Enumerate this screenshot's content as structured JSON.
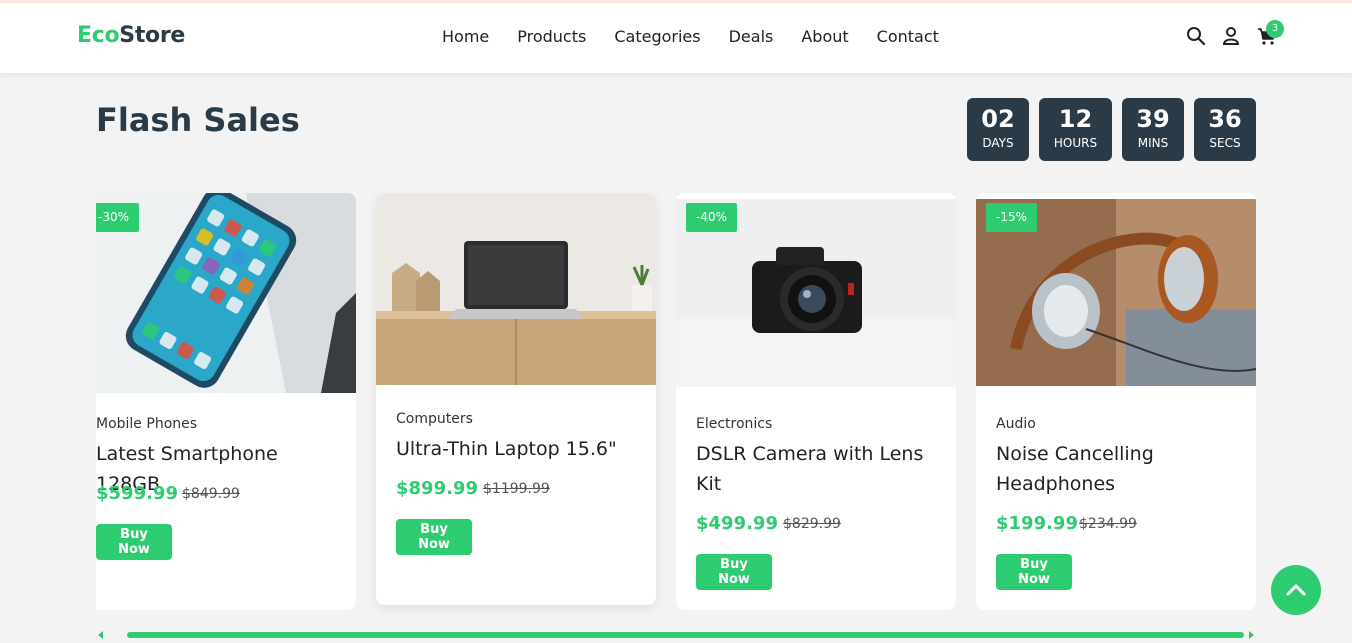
{
  "header": {
    "logo_part1": "Eco",
    "logo_part2": "Store",
    "nav": [
      "Home",
      "Products",
      "Categories",
      "Deals",
      "About",
      "Contact"
    ],
    "cart_count": "3",
    "icons": [
      "search-icon",
      "user-icon",
      "cart-icon"
    ]
  },
  "section": {
    "title": "Flash Sales",
    "countdown": [
      {
        "value": "02",
        "label": "DAYS"
      },
      {
        "value": "12",
        "label": "HOURS"
      },
      {
        "value": "39",
        "label": "MINS"
      },
      {
        "value": "36",
        "label": "SECS"
      }
    ]
  },
  "products": [
    {
      "badge": "-30%",
      "category": "Mobile Phones",
      "title": "Latest Smartphone 128GB",
      "price": "$599.99",
      "old_price": "$849.99",
      "button": "Buy Now"
    },
    {
      "badge": "",
      "category": "Computers",
      "title": "Ultra-Thin Laptop 15.6\"",
      "price": "$899.99",
      "old_price": "$1199.99",
      "button": "Buy Now"
    },
    {
      "badge": "-40%",
      "category": "Electronics",
      "title": "DSLR Camera with Lens Kit",
      "price": "$499.99",
      "old_price": "$829.99",
      "button": "Buy Now"
    },
    {
      "badge": "-15%",
      "category": "Audio",
      "title": "Noise Cancelling Headphones",
      "price": "$199.99",
      "old_price": "$234.99",
      "button": "Buy Now"
    }
  ],
  "colors": {
    "accent": "#2ecc71",
    "dark": "#2a3b47"
  }
}
